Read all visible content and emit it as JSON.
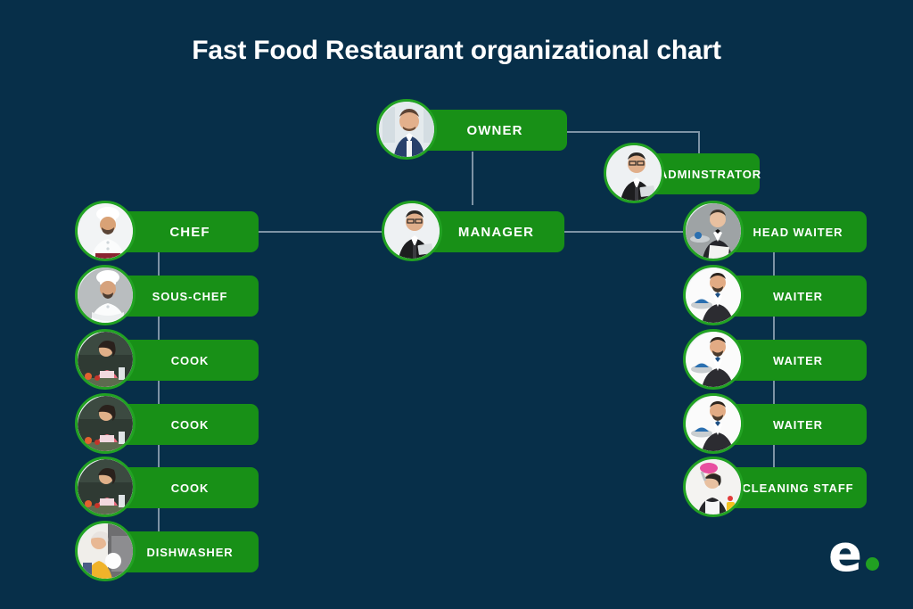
{
  "title": "Fast Food Restaurant organizational chart",
  "colors": {
    "background": "#072f49",
    "node_green": "#189017",
    "avatar_ring": "#22a223",
    "connector": "#7d93a5",
    "title_text": "#ffffff",
    "label_text": "#ffffff",
    "logo_dot": "#21a022"
  },
  "chart_data": {
    "type": "diagram",
    "diagram_type": "organizational-chart",
    "title": "Fast Food Restaurant organizational chart",
    "nodes": [
      {
        "id": "owner",
        "label": "OWNER",
        "avatar": "man-in-blue-suit-photo",
        "level": 0,
        "column": "center"
      },
      {
        "id": "administrator",
        "label": "ADMINSTRATOR",
        "avatar": "man-in-black-suit-with-tablet-photo",
        "level": 1,
        "column": "right"
      },
      {
        "id": "manager",
        "label": "MANAGER",
        "avatar": "man-in-black-suit-with-glasses-photo",
        "level": 1,
        "column": "center"
      },
      {
        "id": "chef",
        "label": "CHEF",
        "avatar": "chef-in-white-coat-photo",
        "level": 2,
        "column": "left"
      },
      {
        "id": "sous-chef",
        "label": "SOUS-CHEF",
        "avatar": "sous-chef-arms-crossed-photo",
        "level": 3,
        "column": "left"
      },
      {
        "id": "cook-1",
        "label": "COOK",
        "avatar": "woman-cooking-photo",
        "level": 4,
        "column": "left"
      },
      {
        "id": "cook-2",
        "label": "COOK",
        "avatar": "woman-cooking-photo",
        "level": 5,
        "column": "left"
      },
      {
        "id": "cook-3",
        "label": "COOK",
        "avatar": "woman-cooking-photo",
        "level": 6,
        "column": "left"
      },
      {
        "id": "dishwasher",
        "label": "DISHWASHER",
        "avatar": "woman-loading-dishwasher-photo",
        "level": 7,
        "column": "left"
      },
      {
        "id": "head-waiter",
        "label": "HEAD WAITER",
        "avatar": "head-waiter-with-tray-photo",
        "level": 2,
        "column": "right"
      },
      {
        "id": "waiter-1",
        "label": "WAITER",
        "avatar": "waiter-with-tray-photo",
        "level": 3,
        "column": "right"
      },
      {
        "id": "waiter-2",
        "label": "WAITER",
        "avatar": "waiter-with-tray-photo",
        "level": 4,
        "column": "right"
      },
      {
        "id": "waiter-3",
        "label": "WAITER",
        "avatar": "waiter-with-tray-photo",
        "level": 5,
        "column": "right"
      },
      {
        "id": "cleaning-staff",
        "label": "CLEANING STAFF",
        "avatar": "cleaning-staff-woman-photo",
        "level": 6,
        "column": "right"
      }
    ],
    "edges": [
      {
        "from": "owner",
        "to": "administrator"
      },
      {
        "from": "owner",
        "to": "manager"
      },
      {
        "from": "manager",
        "to": "chef"
      },
      {
        "from": "manager",
        "to": "head-waiter"
      },
      {
        "from": "chef",
        "to": "sous-chef"
      },
      {
        "from": "chef",
        "to": "cook-1"
      },
      {
        "from": "chef",
        "to": "cook-2"
      },
      {
        "from": "chef",
        "to": "cook-3"
      },
      {
        "from": "chef",
        "to": "dishwasher"
      },
      {
        "from": "head-waiter",
        "to": "waiter-1"
      },
      {
        "from": "head-waiter",
        "to": "waiter-2"
      },
      {
        "from": "head-waiter",
        "to": "waiter-3"
      },
      {
        "from": "head-waiter",
        "to": "cleaning-staff"
      }
    ]
  },
  "logo": {
    "letter": "e",
    "dot": "•"
  }
}
